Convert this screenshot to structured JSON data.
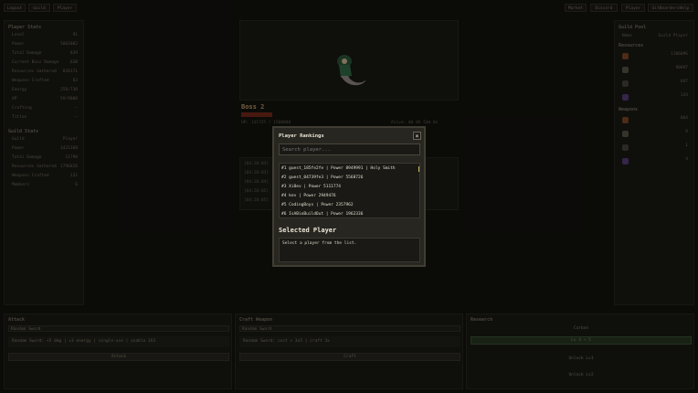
{
  "topnav": {
    "left": [
      "Logout",
      "Guild",
      "Player"
    ],
    "right": [
      "Market",
      "Discord",
      "Player",
      "GitBoardersHelp"
    ]
  },
  "player_stats": {
    "title": "Player Stats",
    "rows": [
      {
        "k": "Level",
        "v": "91"
      },
      {
        "k": "Power",
        "v": "5062002"
      },
      {
        "k": "Total Damage",
        "v": "839"
      },
      {
        "k": "Current Boss Damage",
        "v": "638"
      },
      {
        "k": "Resources Gathered",
        "v": "828171"
      },
      {
        "k": "Weapons Crafted",
        "v": "83"
      },
      {
        "k": "Energy",
        "v": "256/730"
      },
      {
        "k": "XP",
        "v": "59/9000"
      },
      {
        "k": "Crafting",
        "v": "—"
      },
      {
        "k": "Titles",
        "v": "—"
      }
    ],
    "guild_title": "Guild Stats",
    "guild_rows": [
      {
        "k": "Guild",
        "v": "Player"
      },
      {
        "k": "Power",
        "v": "3421368"
      },
      {
        "k": "Total Damage",
        "v": "11798"
      },
      {
        "k": "Resources Gathered",
        "v": "1796826"
      },
      {
        "k": "Weapons Crafted",
        "v": "132"
      },
      {
        "k": "Members",
        "v": "6"
      }
    ]
  },
  "boss": {
    "name": "Boss 2",
    "hp": "HP: 141725 / 1500000",
    "status": "Alive: 0d 0h 53m 0s",
    "log": [
      "[04:28:03]",
      "[04:28:03]",
      "[04:28:04]",
      "[04:28:05]",
      "[04:28:05]"
    ]
  },
  "guild_pool": {
    "title": "Guild Pool",
    "name_label": "Name",
    "name_value": "Guild Player",
    "resources_title": "Resources",
    "resources": [
      "1106096",
      "90097",
      "847",
      "124"
    ],
    "weapons_title": "Weapons",
    "weapons": [
      "864",
      "9",
      "1",
      "4"
    ]
  },
  "bottom": {
    "attack": {
      "title": "Attack",
      "sub": "Random Sword",
      "desc": "Random Sword: +5 dmg | +3 energy | single-use | usable 2h3",
      "button": "Attack"
    },
    "craft": {
      "title": "Craft Weapon",
      "sub": "Random Sword",
      "desc": "Random Sword: cost + 3x5 | craft 3x",
      "button": "Craft"
    },
    "research": {
      "title": "Research",
      "head": "Carbon",
      "items": [
        "Lv 4 → 5",
        "Unlock Lv1",
        "Unlock Lv2"
      ]
    }
  },
  "modal": {
    "title": "Player Rankings",
    "close": "×",
    "search_placeholder": "Search player...",
    "rankings": [
      "#1 guest_185fe2fe | Power 8949991 | Holy Smith",
      "#2 guest_04739fe3 | Power 5568726",
      "#3 Xi8ev | Power 5111774",
      "#4 kev | Power 2949476",
      "#5 CodingBoys | Power 2357962",
      "#6 IsABioBuildOut | Power 1962336"
    ],
    "selected_title": "Selected Player",
    "selected_text": "Select a player from the list."
  },
  "colors": {
    "accent": "#c9c06a",
    "boss_name": "#c8a06a",
    "hpbar": "#7a2a1c"
  }
}
